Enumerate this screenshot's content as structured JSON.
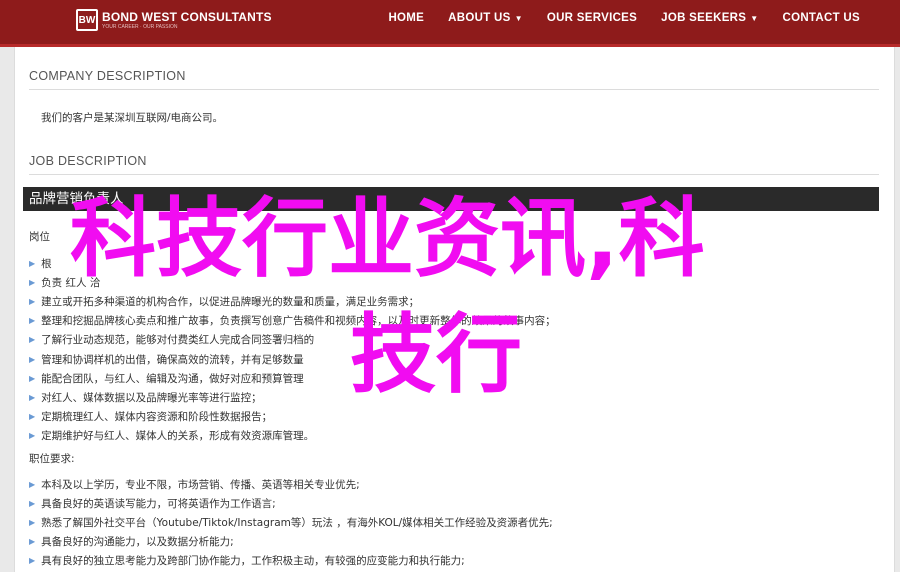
{
  "logo": {
    "mark": "BW",
    "name": "BOND WEST CONSULTANTS",
    "tagline": "YOUR CAREER · OUR PASSION"
  },
  "nav": [
    {
      "label": "HOME",
      "dropdown": false
    },
    {
      "label": "ABOUT US",
      "dropdown": true
    },
    {
      "label": "OUR SERVICES",
      "dropdown": false
    },
    {
      "label": "JOB SEEKERS",
      "dropdown": true
    },
    {
      "label": "CONTACT US",
      "dropdown": false
    }
  ],
  "icons": {
    "dropdown": "chevron-down-icon",
    "bullet": "triangle-bullet-icon"
  },
  "colors": {
    "navbar": "#8e1b1b",
    "job_bar": "#2a2a2a",
    "overlay_text": "#f10cf1",
    "bullet": "#6a9ad4"
  },
  "company": {
    "heading": "COMPANY DESCRIPTION",
    "text": "我们的客户是某深圳互联网/电商公司。"
  },
  "job": {
    "heading": "JOB DESCRIPTION",
    "title": "品牌营销负责人",
    "duties_label": "岗位",
    "duties": [
      "根",
      "负责                        红人                  洽",
      "建立或开拓多种渠道的机构合作，以促进品牌曝光的数量和质量，满足业务需求；",
      "整理和挖掘品牌核心卖点和推广故事，负责撰写创意广告稿件和视频内容，以及时更新整体的效果的故事内容；",
      "了解行业动态规范，能够对付费类红人完成合同签署归档的",
      "管理和协调样机的出借，确保高效的流转，并有足够数量",
      "能配合团队，与红人、编辑及沟通，做好对应和预算管理",
      "对红人、媒体数据以及品牌曝光率等进行监控；",
      "定期梳理红人、媒体内容资源和阶段性数据报告；",
      "定期维护好与红人、媒体人的关系，形成有效资源库管理。"
    ],
    "requirements_label": "职位要求:",
    "requirements": [
      "本科及以上学历，专业不限，市场营销、传播、英语等相关专业优先;",
      "具备良好的英语读写能力，可将英语作为工作语言;",
      "熟悉了解国外社交平台（Youtube/Tiktok/Instagram等）玩法 ，有海外KOL/媒体相关工作经验及资源者优先;",
      "具备良好的沟通能力，以及数据分析能力;",
      "具有良好的独立思考能力及跨部门协作能力，工作积极主动，有较强的应变能力和执行能力;"
    ]
  },
  "overlay": {
    "line1": "科技行业资讯,科",
    "line2": "技行"
  }
}
